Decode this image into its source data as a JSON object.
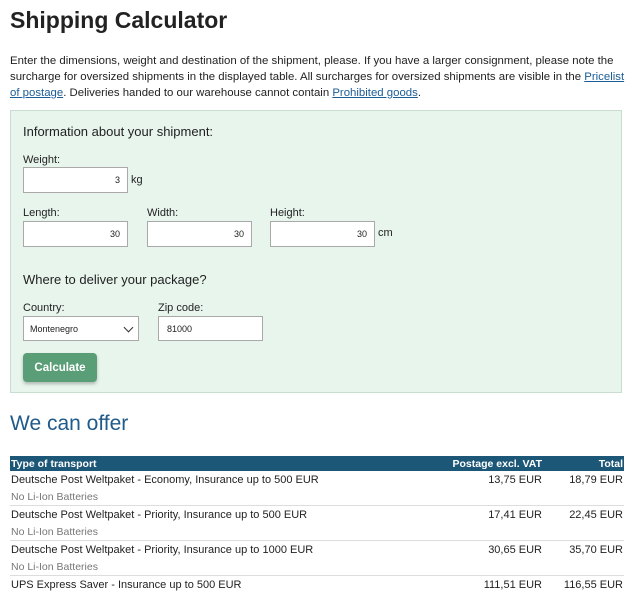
{
  "header": {
    "title": "Shipping Calculator"
  },
  "intro": {
    "text1": "Enter the dimensions, weight and destination of the shipment, please. If you have a larger consignment, please note the surcharge for oversized shipments in the displayed table. All surcharges for oversized shipments are visible in the ",
    "link1": "Pricelist of postage",
    "text2": ". Deliveries handed to our warehouse cannot contain ",
    "link2": "Prohibited goods",
    "text3": "."
  },
  "form": {
    "shipment_heading": "Information about your shipment:",
    "weight_label": "Weight:",
    "weight_value": "3",
    "weight_unit": "kg",
    "length_label": "Length:",
    "length_value": "30",
    "width_label": "Width:",
    "width_value": "30",
    "height_label": "Height:",
    "height_value": "30",
    "dimension_unit": "cm",
    "delivery_heading": "Where to deliver your package?",
    "country_label": "Country:",
    "country_value": "Montenegro",
    "zip_label": "Zip code:",
    "zip_value": "81000",
    "calculate_label": "Calculate"
  },
  "offers": {
    "heading": "We can offer",
    "columns": [
      "Type of transport",
      "Postage excl. VAT",
      "Total"
    ],
    "rows": [
      {
        "name": "Deutsche Post Weltpaket - Economy, Insurance up to 500 EUR",
        "note": "No Li-Ion Batteries",
        "postage": "13,75 EUR",
        "total": "18,79 EUR"
      },
      {
        "name": "Deutsche Post Weltpaket - Priority, Insurance up to 500 EUR",
        "note": "No Li-Ion Batteries",
        "postage": "17,41 EUR",
        "total": "22,45 EUR"
      },
      {
        "name": "Deutsche Post Weltpaket - Priority, Insurance up to 1000 EUR",
        "note": "No Li-Ion Batteries",
        "postage": "30,65 EUR",
        "total": "35,70 EUR"
      },
      {
        "name": "UPS Express Saver - Insurance up to 500 EUR",
        "note": "",
        "postage": "111,51 EUR",
        "total": "116,55 EUR"
      }
    ]
  }
}
